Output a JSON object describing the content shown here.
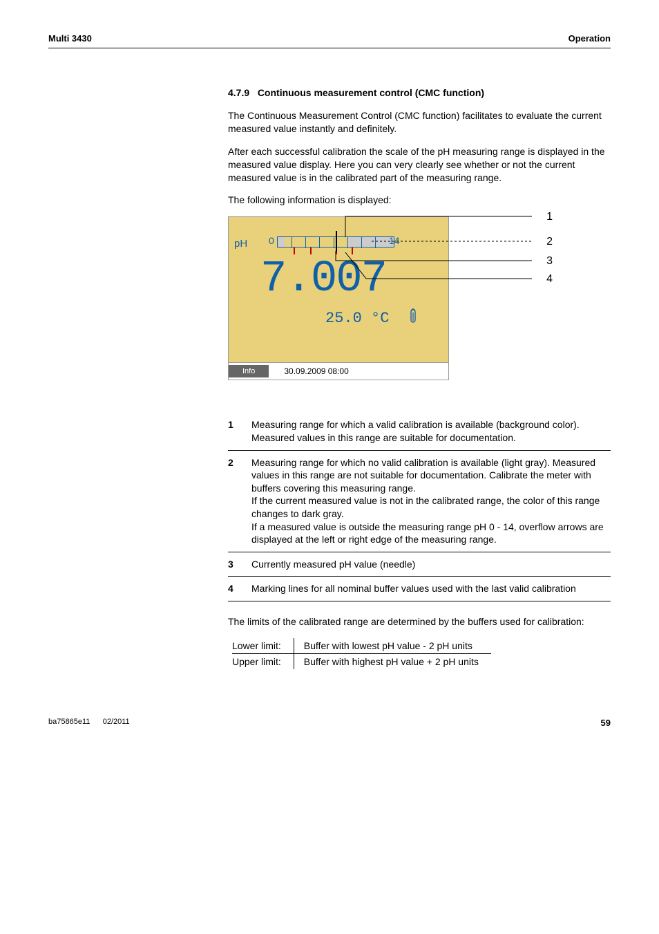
{
  "header": {
    "left": "Multi 3430",
    "right": "Operation"
  },
  "section": {
    "number": "4.7.9",
    "title": "Continuous measurement control (CMC function)"
  },
  "paragraphs": {
    "p1": "The Continuous Measurement Control (CMC function) facilitates to evaluate the current measured value instantly and definitely.",
    "p2": "After each successful calibration the scale of the pH measuring range is displayed in the measured value display. Here you can very clearly see whether or not the current measured value is in the calibrated part of the measuring range.",
    "p3": "The following information is displayed:",
    "p4": "The limits of the calibrated range are determined by the buffers used for calibration:"
  },
  "display": {
    "mode_label": "pH",
    "scale_min": "0",
    "scale_max": "14",
    "value": "7.007",
    "temperature": "25.0 °C",
    "info_label": "Info",
    "timestamp": "30.09.2009 08:00",
    "callouts": {
      "c1": "1",
      "c2": "2",
      "c3": "3",
      "c4": "4"
    }
  },
  "definitions": {
    "d1": {
      "num": "1",
      "text": "Measuring range for which a valid calibration is available (background color). Measured values in this range are suitable for documentation."
    },
    "d2": {
      "num": "2",
      "text": "Measuring range for which no valid calibration is available (light gray). Measured values in this range are not suitable for documentation. Calibrate the meter with buffers covering this measuring range.\nIf the current measured value is not in the calibrated range, the color of this range changes to dark gray.\nIf a measured value is outside the measuring range pH 0 - 14, overflow arrows are displayed at the left or right edge of the measuring range."
    },
    "d3": {
      "num": "3",
      "text": "Currently measured pH value (needle)"
    },
    "d4": {
      "num": "4",
      "text": "Marking lines for all nominal buffer values used with the last valid calibration"
    }
  },
  "limits": {
    "lower": {
      "label": "Lower limit:",
      "value": "Buffer with lowest pH value - 2 pH units"
    },
    "upper": {
      "label": "Upper limit:",
      "value": "Buffer with highest pH value + 2 pH units"
    }
  },
  "footer": {
    "doc_id": "ba75865e11",
    "date": "02/2011",
    "page": "59"
  },
  "chart_data": {
    "type": "scale",
    "axis": {
      "min": 0,
      "max": 14,
      "label": "pH"
    },
    "calibrated_range": [
      1,
      9
    ],
    "uncalibrated_ranges": [
      [
        0,
        1
      ],
      [
        9,
        14
      ]
    ],
    "buffer_markers": [
      2,
      4,
      7,
      9
    ],
    "needle_value": 7.007,
    "temperature_c": 25.0
  }
}
